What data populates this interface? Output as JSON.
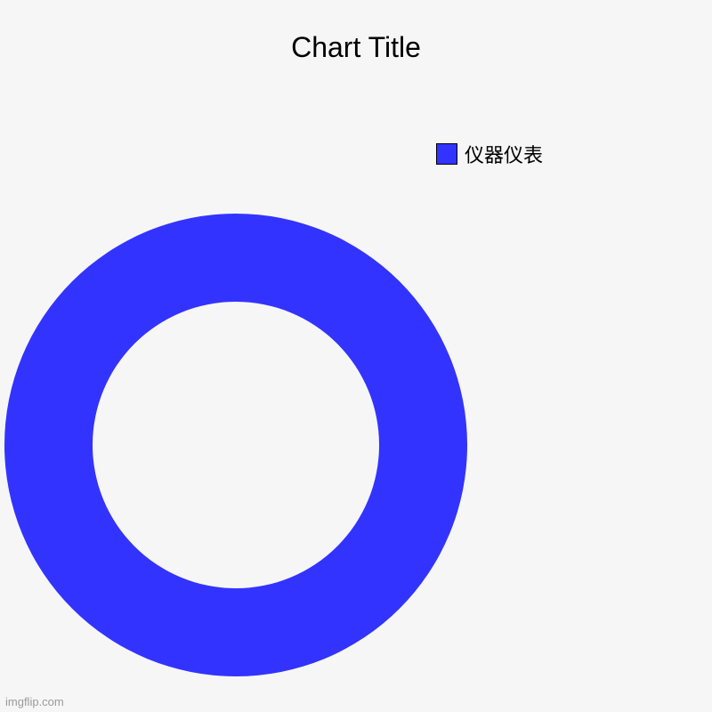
{
  "chart_data": {
    "type": "pie",
    "title": "Chart Title",
    "series": [
      {
        "name": "仪器仪表",
        "value": 100,
        "color": "#3333ff"
      }
    ],
    "donut": true,
    "inner_radius_ratio": 0.62
  },
  "legend": {
    "items": [
      {
        "label": "仪器仪表",
        "color": "#3333ff"
      }
    ]
  },
  "watermark": "imgflip.com"
}
